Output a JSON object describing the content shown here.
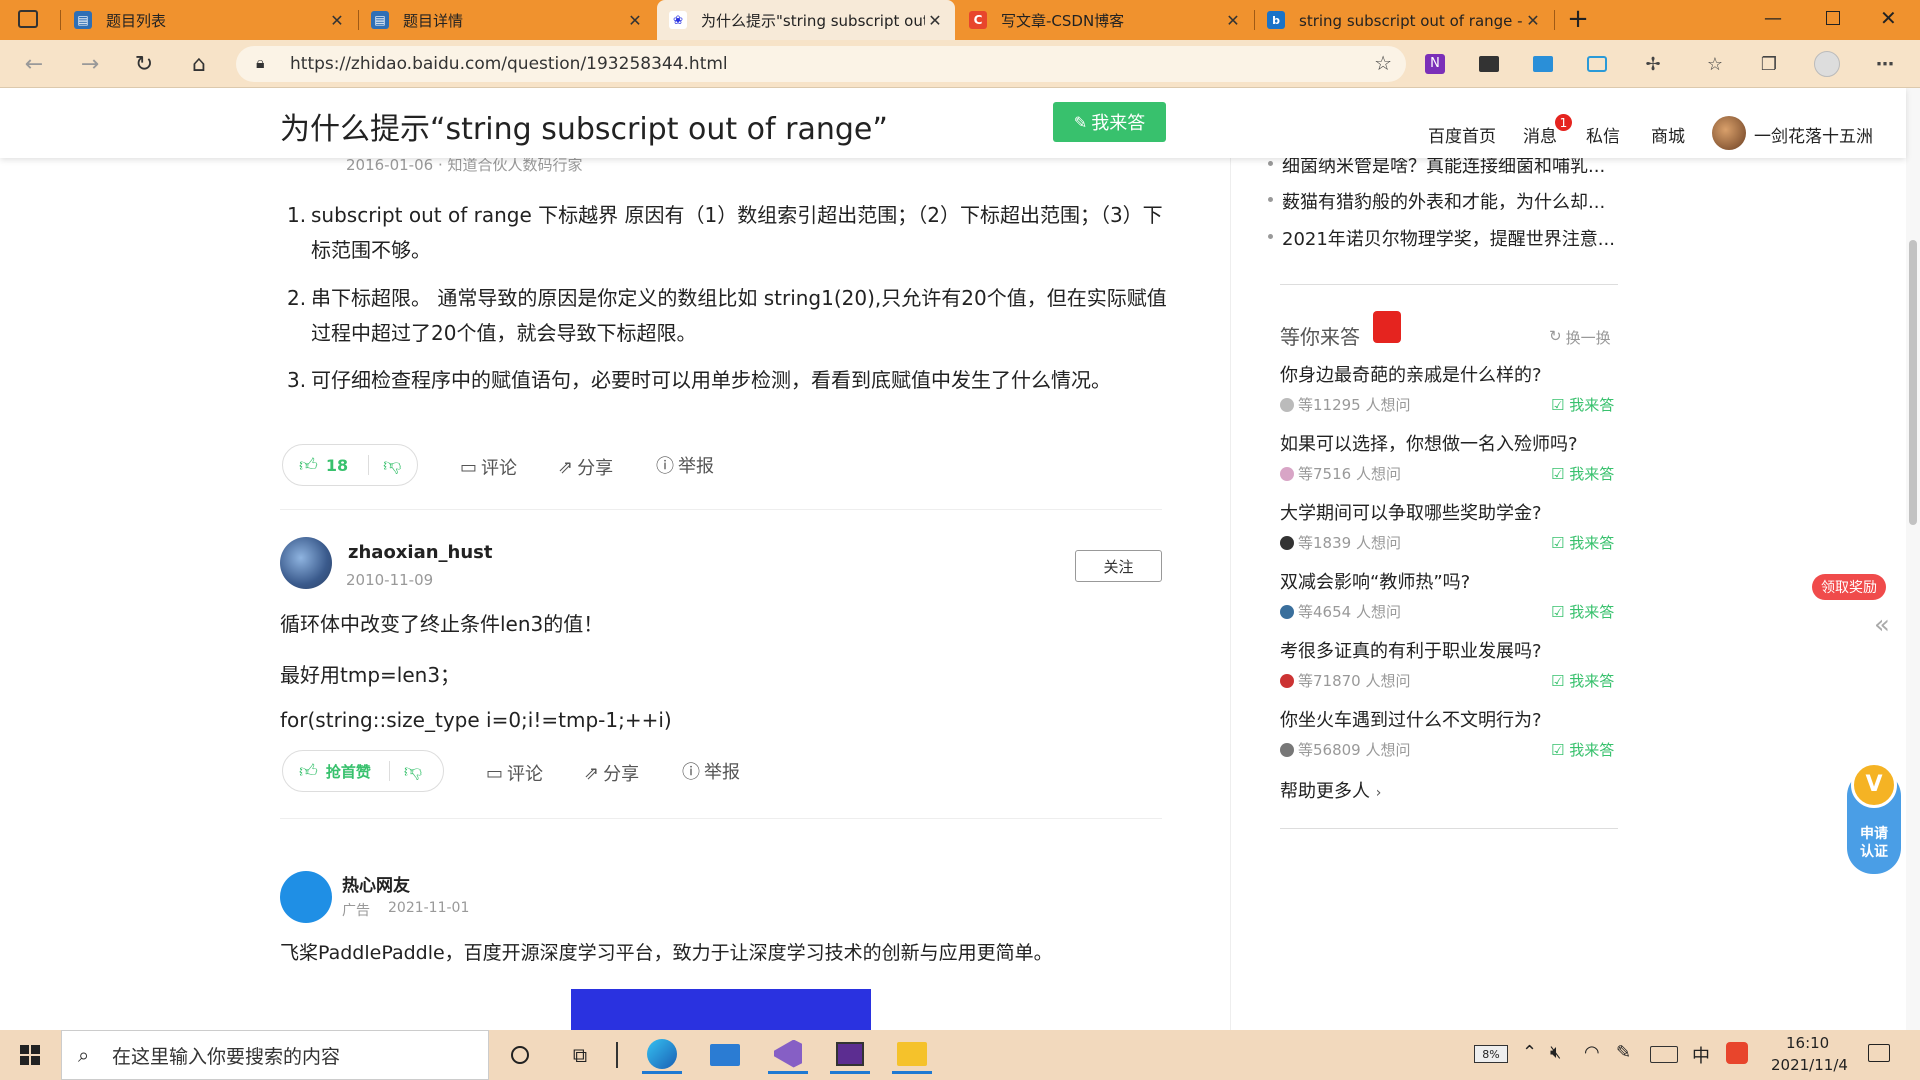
{
  "browser": {
    "tabs": [
      {
        "title": "题目列表",
        "active": false
      },
      {
        "title": "题目详情",
        "active": false
      },
      {
        "title": "为什么提示\"string subscript out o",
        "active": true
      },
      {
        "title": "写文章-CSDN博客",
        "active": false
      },
      {
        "title": "string subscript out of range - 百",
        "active": false
      }
    ],
    "new_tab_label": "+",
    "url": "https://zhidao.baidu.com/question/193258344.html"
  },
  "header": {
    "question_title": "为什么提示“string subscript out of range”",
    "answer_button": "我来答",
    "nav": [
      "百度首页",
      "消息",
      "私信",
      "商城"
    ],
    "message_badge": "1",
    "username": "一剑花落十五洲"
  },
  "answer1": {
    "meta_partial": "2016-01-06 · 知道合伙人数码行家",
    "items": [
      {
        "num": "1.",
        "text": "subscript out of range 下标越界 原因有（1）数组索引超出范围；（2）下标超出范围；（3）下标范围不够。"
      },
      {
        "num": "2.",
        "text": "串下标超限。 通常导致的原因是你定义的数组比如 string1(20),只允许有20个值，但在实际赋值过程中超过了20个值，就会导致下标超限。"
      },
      {
        "num": "3.",
        "text": "可仔细检查程序中的赋值语句，必要时可以用单步检测，看看到底赋值中发生了什么情况。"
      }
    ],
    "likes": "18",
    "comment": "评论",
    "share": "分享",
    "report": "举报"
  },
  "answer2": {
    "username": "zhaoxian_hust",
    "date": "2010-11-09",
    "follow": "关注",
    "lines": [
      "循环体中改变了终止条件len3的值！",
      "最好用tmp=len3；",
      "for(string::size_type i=0;i!=tmp-1;++i)"
    ],
    "likes": "抢首赞",
    "comment": "评论",
    "share": "分享",
    "report": "举报"
  },
  "ad": {
    "username": "热心网友",
    "tag": "广告",
    "date": "2021-11-01",
    "text": "飞桨PaddlePaddle，百度开源深度学习平台，致力于让深度学习技术的创新与应用更简单。"
  },
  "sidebar": {
    "news": [
      "细菌纳米管是啥？真能连接细菌和哺乳...",
      "薮猫有猎豹般的外表和才能，为什么却...",
      "2021年诺贝尔物理学奖，提醒世界注意..."
    ],
    "waiting_title": "等你来答",
    "refresh": "换一换",
    "questions": [
      {
        "q": "你身边最奇葩的亲戚是什么样的?",
        "count": "等11295 人想问"
      },
      {
        "q": "如果可以选择，你想做一名入殓师吗?",
        "count": "等7516 人想问"
      },
      {
        "q": "大学期间可以争取哪些奖助学金?",
        "count": "等1839 人想问"
      },
      {
        "q": "双减会影响“教师热”吗?",
        "count": "等4654 人想问"
      },
      {
        "q": "考很多证真的有利于职业发展吗?",
        "count": "等71870 人想问"
      },
      {
        "q": "你坐火车遇到过什么不文明行为?",
        "count": "等56809 人想问"
      }
    ],
    "answer_label": "我来答",
    "help_more": "帮助更多人",
    "reward": "领取奖励",
    "apply": "申请认证"
  },
  "taskbar": {
    "search_placeholder": "在这里输入你要搜索的内容",
    "battery": "8%",
    "ime": "中",
    "time": "16:10",
    "date": "2021/11/4"
  },
  "colors": {
    "tabbar": "#f0922e",
    "green": "#38c16d",
    "red": "#e5241f"
  }
}
